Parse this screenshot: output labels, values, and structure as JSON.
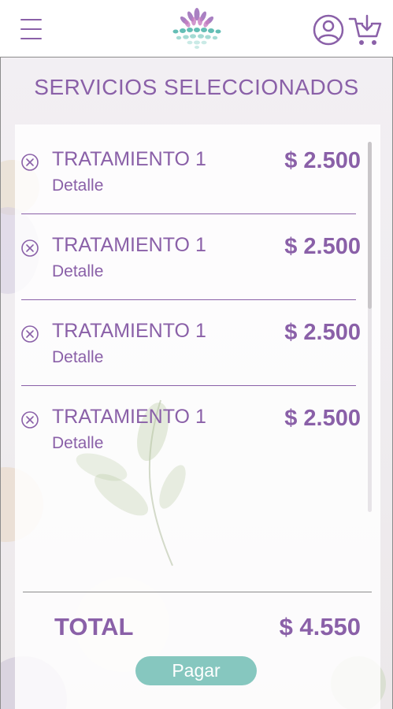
{
  "header": {
    "menu_icon": "hamburger-menu-icon",
    "logo_icon": "lotus-logo-icon",
    "user_icon": "user-circle-icon",
    "cart_icon": "cart-download-icon",
    "accent_color": "#8a60a8"
  },
  "page": {
    "title": "SERVICIOS SELECCIONADOS"
  },
  "items": [
    {
      "name": "TRATAMIENTO 1",
      "detail": "Detalle",
      "price": "$ 2.500",
      "remove_icon": "circle-x-icon"
    },
    {
      "name": "TRATAMIENTO 1",
      "detail": "Detalle",
      "price": "$ 2.500",
      "remove_icon": "circle-x-icon"
    },
    {
      "name": "TRATAMIENTO 1",
      "detail": "Detalle",
      "price": "$ 2.500",
      "remove_icon": "circle-x-icon"
    },
    {
      "name": "TRATAMIENTO 1",
      "detail": "Detalle",
      "price": "$ 2.500",
      "remove_icon": "circle-x-icon"
    }
  ],
  "summary": {
    "total_label": "TOTAL",
    "total_value": "$ 4.550",
    "pay_label": "Pagar",
    "pay_color": "#86c7bf"
  }
}
